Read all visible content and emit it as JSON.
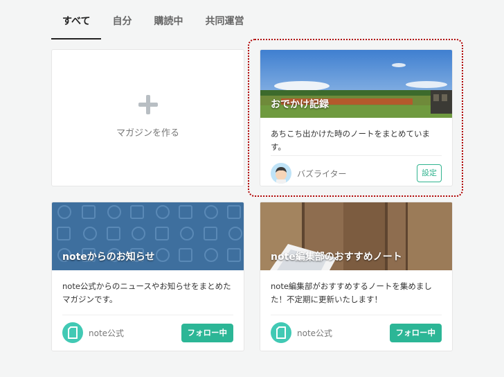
{
  "tabs": [
    "すべて",
    "自分",
    "購読中",
    "共同運営"
  ],
  "create": {
    "label": "マガジンを作る"
  },
  "magazines": [
    {
      "title": "おでかけ記録",
      "description": "あちこち出かけた時のノートをまとめています。",
      "author": "バズライター",
      "action": "設定"
    },
    {
      "title": "noteからのお知らせ",
      "description": "note公式からのニュースやお知らせをまとめたマガジンです。",
      "author": "note公式",
      "action": "フォロー中"
    },
    {
      "title": "note編集部のおすすめノート",
      "description": "note編集部がおすすめするノートを集めました！不定期に更新いたします！",
      "author": "note公式",
      "action": "フォロー中"
    }
  ],
  "colors": {
    "accent": "#2cb696",
    "highlight": "#b00000"
  }
}
